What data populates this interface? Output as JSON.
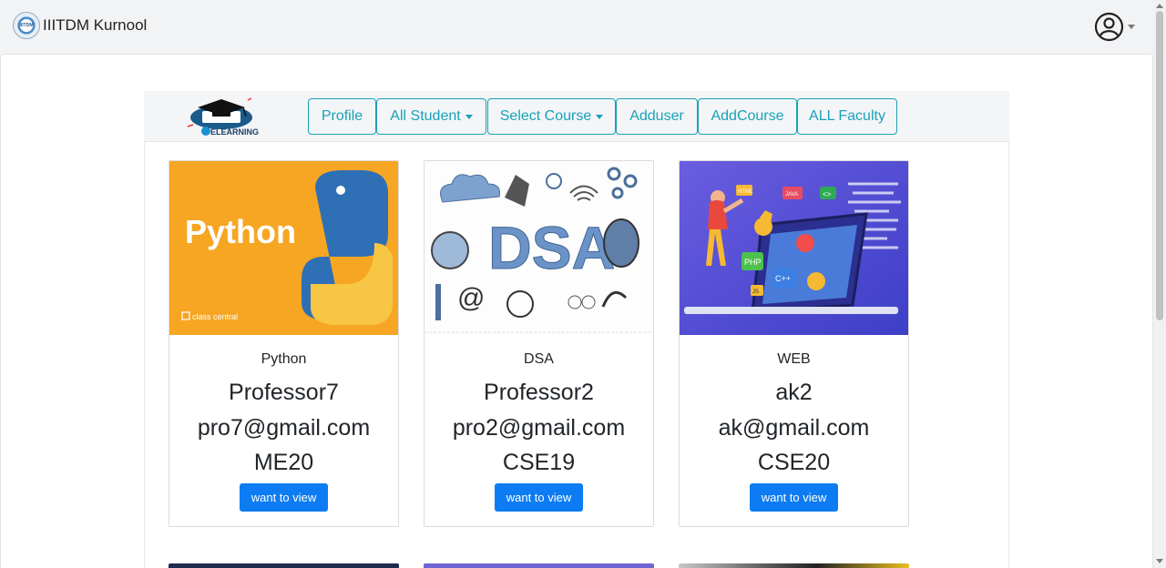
{
  "header": {
    "brand": "IIITDM Kurnool",
    "logo_text": "IIITDM"
  },
  "subnav": {
    "logo_label": "ELEARNING",
    "buttons": {
      "profile": "Profile",
      "all_student": "All Student",
      "select_course": "Select Course",
      "adduser": "Adduser",
      "addcourse": "AddCourse",
      "all_faculty": "ALL Faculty"
    }
  },
  "courses": [
    {
      "name": "Python",
      "professor": "Professor7",
      "email": "pro7@gmail.com",
      "code": "ME20",
      "button": "want to view",
      "image_text": "Python",
      "image_footer": "class central"
    },
    {
      "name": "DSA",
      "professor": "Professor2",
      "email": "pro2@gmail.com",
      "code": "CSE19",
      "button": "want to view",
      "image_text": "DSA"
    },
    {
      "name": "WEB",
      "professor": "ak2",
      "email": "ak@gmail.com",
      "code": "CSE20",
      "button": "want to view",
      "image_tags": {
        "html": "HTML",
        "java": "JAVA",
        "code": "<>",
        "php": "PHP",
        "cpp": "C++",
        "js": "JS"
      }
    }
  ],
  "colors": {
    "accent": "#17a2b8",
    "primary_button": "#0d7cf2",
    "python_bg": "#f6a623",
    "web_bg": "#5a4fd6"
  }
}
